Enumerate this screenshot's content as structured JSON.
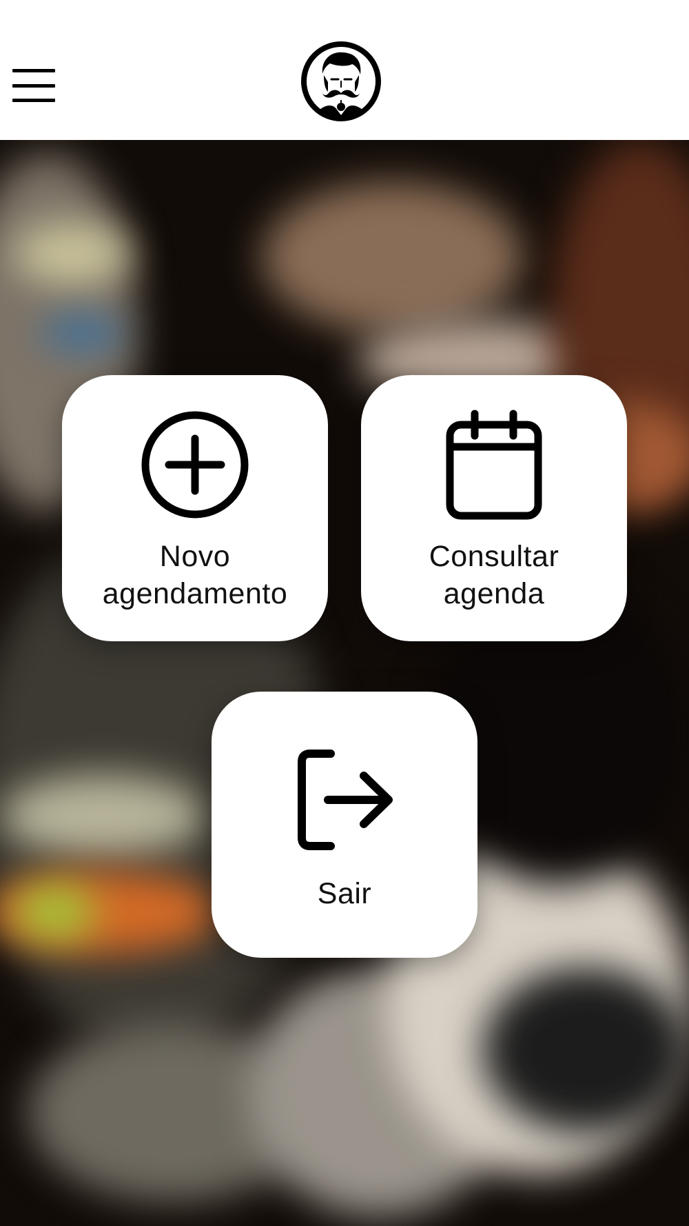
{
  "header": {
    "menu_icon": "hamburger-menu-icon",
    "logo_icon": "barber-mustache-logo-icon"
  },
  "tiles": {
    "new_appointment": {
      "icon": "plus-circle-icon",
      "label_line1": "Novo",
      "label_line2": "agendamento"
    },
    "view_schedule": {
      "icon": "calendar-icon",
      "label_line1": "Consultar",
      "label_line2": "agenda"
    },
    "logout": {
      "icon": "logout-icon",
      "label": "Sair"
    }
  },
  "colors": {
    "header_bg": "#ffffff",
    "tile_bg": "#ffffff",
    "icon_color": "#000000",
    "text_color": "#111111"
  }
}
